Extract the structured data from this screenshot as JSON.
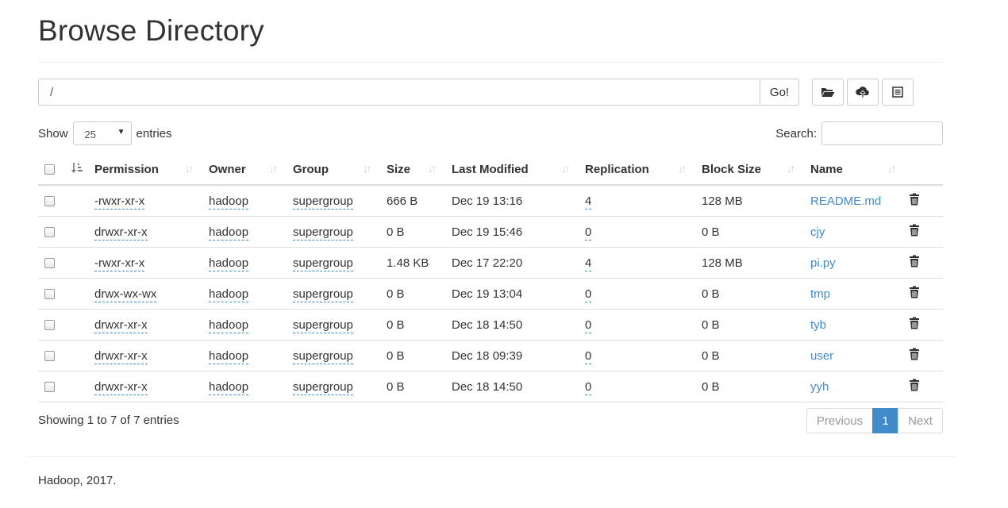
{
  "page": {
    "title": "Browse Directory"
  },
  "path_bar": {
    "value": "/",
    "go_label": "Go!"
  },
  "toolbar": {
    "icons": [
      "folder-open-icon",
      "cloud-upload-icon",
      "list-icon"
    ]
  },
  "length_control": {
    "show_label": "Show",
    "selected": "25",
    "entries_label": "entries"
  },
  "search": {
    "label": "Search:",
    "value": ""
  },
  "table": {
    "columns": [
      "Permission",
      "Owner",
      "Group",
      "Size",
      "Last Modified",
      "Replication",
      "Block Size",
      "Name"
    ],
    "rows": [
      {
        "permission": "-rwxr-xr-x",
        "owner": "hadoop",
        "group": "supergroup",
        "size": "666 B",
        "modified": "Dec 19 13:16",
        "replication": "4",
        "block_size": "128 MB",
        "name": "README.md"
      },
      {
        "permission": "drwxr-xr-x",
        "owner": "hadoop",
        "group": "supergroup",
        "size": "0 B",
        "modified": "Dec 19 15:46",
        "replication": "0",
        "block_size": "0 B",
        "name": "cjy"
      },
      {
        "permission": "-rwxr-xr-x",
        "owner": "hadoop",
        "group": "supergroup",
        "size": "1.48 KB",
        "modified": "Dec 17 22:20",
        "replication": "4",
        "block_size": "128 MB",
        "name": "pi.py"
      },
      {
        "permission": "drwx-wx-wx",
        "owner": "hadoop",
        "group": "supergroup",
        "size": "0 B",
        "modified": "Dec 19 13:04",
        "replication": "0",
        "block_size": "0 B",
        "name": "tmp"
      },
      {
        "permission": "drwxr-xr-x",
        "owner": "hadoop",
        "group": "supergroup",
        "size": "0 B",
        "modified": "Dec 18 14:50",
        "replication": "0",
        "block_size": "0 B",
        "name": "tyb"
      },
      {
        "permission": "drwxr-xr-x",
        "owner": "hadoop",
        "group": "supergroup",
        "size": "0 B",
        "modified": "Dec 18 09:39",
        "replication": "0",
        "block_size": "0 B",
        "name": "user"
      },
      {
        "permission": "drwxr-xr-x",
        "owner": "hadoop",
        "group": "supergroup",
        "size": "0 B",
        "modified": "Dec 18 14:50",
        "replication": "0",
        "block_size": "0 B",
        "name": "yyh"
      }
    ]
  },
  "table_info": "Showing 1 to 7 of 7 entries",
  "pagination": {
    "previous": "Previous",
    "current": "1",
    "next": "Next"
  },
  "footer": {
    "text": "Hadoop, 2017."
  },
  "colors": {
    "link": "#428bca",
    "active_page": "#428bca"
  }
}
